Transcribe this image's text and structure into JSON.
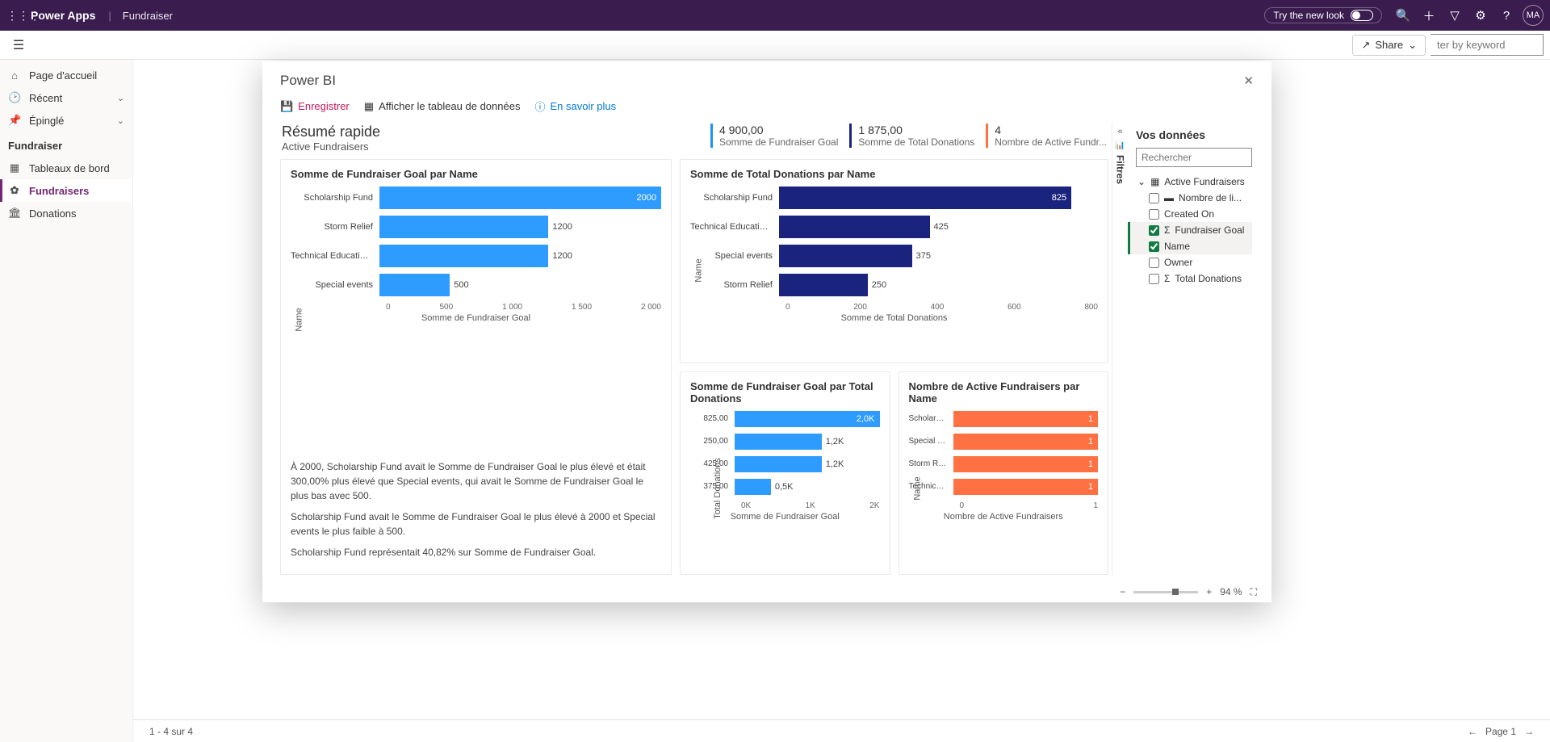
{
  "topbar": {
    "brand": "Power Apps",
    "appname": "Fundraiser",
    "tryLabel": "Try the new look",
    "avatar": "MA"
  },
  "cmdbar": {
    "shareLabel": "Share",
    "filterPlaceholder": "ter by keyword"
  },
  "leftnav": {
    "home": "Page d'accueil",
    "recent": "Récent",
    "pinned": "Épinglé",
    "section": "Fundraiser",
    "dashboards": "Tableaux de bord",
    "fundraisers": "Fundraisers",
    "donations": "Donations"
  },
  "modal": {
    "title": "Power BI",
    "save": "Enregistrer",
    "showTable": "Afficher le tableau de données",
    "learnMore": "En savoir plus"
  },
  "summary": {
    "heading": "Résumé rapide",
    "subtitle": "Active Fundraisers",
    "kpi1_val": "4 900,00",
    "kpi1_lbl": "Somme de Fundraiser Goal",
    "kpi2_val": "1 875,00",
    "kpi2_lbl": "Somme de Total Donations",
    "kpi3_val": "4",
    "kpi3_lbl": "Nombre de Active Fundr..."
  },
  "cardTitles": {
    "c1": "Somme de Fundraiser Goal par Name",
    "c2": "Somme de Total Donations par Name",
    "c3": "Somme de Fundraiser Goal par Total Donations",
    "c4": "Nombre de Active Fundraisers par Name"
  },
  "chart_data": [
    {
      "type": "bar",
      "orientation": "horizontal",
      "title": "Somme de Fundraiser Goal par Name",
      "ylabel": "Name",
      "xlabel": "Somme de Fundraiser Goal",
      "xticks": [
        "0",
        "500",
        "1 000",
        "1 500",
        "2 000"
      ],
      "xlim": [
        0,
        2000
      ],
      "categories": [
        "Scholarship Fund",
        "Storm Relief",
        "Technical Education for ...",
        "Special events"
      ],
      "values": [
        2000,
        1200,
        1200,
        500
      ],
      "value_labels": [
        "2000",
        "1200",
        "1200",
        "500"
      ],
      "color": "#2e9bff"
    },
    {
      "type": "bar",
      "orientation": "horizontal",
      "title": "Somme de Total Donations par Name",
      "ylabel": "Name",
      "xlabel": "Somme de Total Donations",
      "xticks": [
        "0",
        "200",
        "400",
        "600",
        "800"
      ],
      "xlim": [
        0,
        900
      ],
      "categories": [
        "Scholarship Fund",
        "Technical Education for ...",
        "Special events",
        "Storm Relief"
      ],
      "values": [
        825,
        425,
        375,
        250
      ],
      "value_labels": [
        "825",
        "425",
        "375",
        "250"
      ],
      "color": "#1a237e"
    },
    {
      "type": "bar",
      "orientation": "horizontal",
      "title": "Somme de Fundraiser Goal par Total Donations",
      "ylabel": "Total Donations",
      "xlabel": "Somme de Fundraiser Goal",
      "xticks": [
        "0K",
        "1K",
        "2K"
      ],
      "xlim": [
        0,
        2000
      ],
      "categories": [
        "825,00",
        "250,00",
        "425,00",
        "375,00"
      ],
      "values": [
        2000,
        1200,
        1200,
        500
      ],
      "value_labels": [
        "2,0K",
        "1,2K",
        "1,2K",
        "0,5K"
      ],
      "color": "#2e9bff"
    },
    {
      "type": "bar",
      "orientation": "horizontal",
      "title": "Nombre de Active Fundraisers par Name",
      "ylabel": "Name",
      "xlabel": "Nombre de Active Fundraisers",
      "xticks": [
        "0",
        "1"
      ],
      "xlim": [
        0,
        1
      ],
      "categories": [
        "Scholarsh...",
        "Special e...",
        "Storm Rel...",
        "Technical..."
      ],
      "values": [
        1,
        1,
        1,
        1
      ],
      "value_labels": [
        "1",
        "1",
        "1",
        "1"
      ],
      "color": "#ff7043"
    }
  ],
  "insights": {
    "p1": "À 2000, Scholarship Fund avait le Somme de Fundraiser Goal le plus élevé et était 300,00% plus élevé que Special events, qui avait le Somme de Fundraiser Goal le plus bas avec 500.",
    "p2": "Scholarship Fund avait le Somme de Fundraiser Goal le plus élevé à 2000 et Special events le plus faible à 500.",
    "p3": "Scholarship Fund représentait 40,82% sur Somme de Fundraiser Goal."
  },
  "filters": {
    "label": "Filtres"
  },
  "datapane": {
    "title": "Vos données",
    "searchPlaceholder": "Rechercher",
    "tableName": "Active Fundraisers",
    "fields": {
      "f1": "Nombre de li...",
      "f2": "Created On",
      "f3": "Fundraiser Goal",
      "f4": "Name",
      "f5": "Owner",
      "f6": "Total Donations"
    }
  },
  "footer": {
    "zoom": "94 %",
    "count": "1 - 4 sur 4",
    "page": "Page 1"
  }
}
